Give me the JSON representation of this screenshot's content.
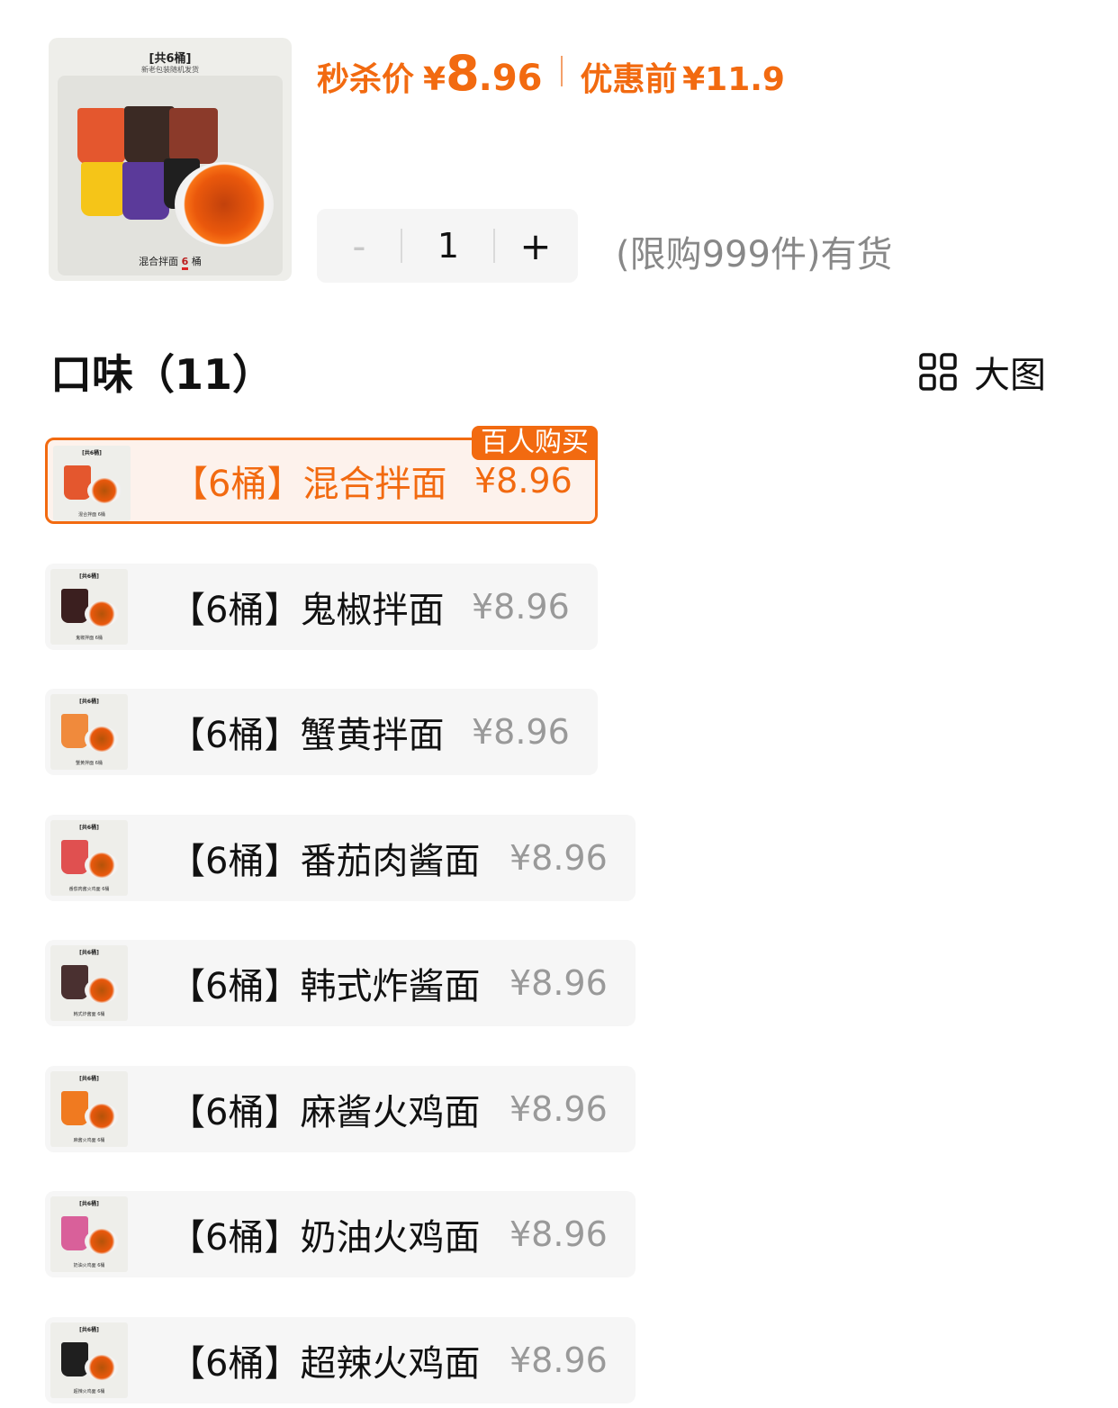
{
  "product_image": {
    "title": "[共6桶]",
    "subtitle": "新老包装随机发货",
    "caption_prefix": "混合拌面",
    "caption_count": "6",
    "caption_suffix": "桶"
  },
  "price": {
    "flash_label": "秒杀价",
    "currency": "¥",
    "flash_int": "8",
    "flash_dec": ".96",
    "original_label": "优惠前",
    "original_price": "¥11.9"
  },
  "quantity": {
    "minus": "-",
    "value": "1",
    "plus": "+"
  },
  "stock_text": "(限购999件)有货",
  "section": {
    "title": "口味（11）",
    "view_toggle_label": "大图"
  },
  "colors": {
    "accent": "#f26a10",
    "muted_price": "#999999",
    "chip_bg": "#f6f6f6"
  },
  "options": [
    {
      "name": "【6桶】混合拌面",
      "price": "¥8.96",
      "badge": "百人购买",
      "selected": true,
      "cup_color": "#e4572e",
      "thumb_caption": "混合拌面 6桶"
    },
    {
      "name": "【6桶】鬼椒拌面",
      "price": "¥8.96",
      "badge": "",
      "selected": false,
      "cup_color": "#3b1f1f",
      "thumb_caption": "鬼椒拌面 6桶"
    },
    {
      "name": "【6桶】蟹黄拌面",
      "price": "¥8.96",
      "badge": "",
      "selected": false,
      "cup_color": "#f08a3c",
      "thumb_caption": "蟹黄拌面 6桶"
    },
    {
      "name": "【6桶】番茄肉酱面",
      "price": "¥8.96",
      "badge": "",
      "selected": false,
      "cup_color": "#e05050",
      "thumb_caption": "番茄肉酱火鸡面 6桶"
    },
    {
      "name": "【6桶】韩式炸酱面",
      "price": "¥8.96",
      "badge": "",
      "selected": false,
      "cup_color": "#4a3030",
      "thumb_caption": "韩式炸酱面 6桶"
    },
    {
      "name": "【6桶】麻酱火鸡面",
      "price": "¥8.96",
      "badge": "",
      "selected": false,
      "cup_color": "#f07a20",
      "thumb_caption": "麻酱火鸡面 6桶"
    },
    {
      "name": "【6桶】奶油火鸡面",
      "price": "¥8.96",
      "badge": "",
      "selected": false,
      "cup_color": "#d9609a",
      "thumb_caption": "奶油火鸡面 6桶"
    },
    {
      "name": "【6桶】超辣火鸡面",
      "price": "¥8.96",
      "badge": "",
      "selected": false,
      "cup_color": "#1f1f1f",
      "thumb_caption": "超辣火鸡面 6桶"
    }
  ]
}
